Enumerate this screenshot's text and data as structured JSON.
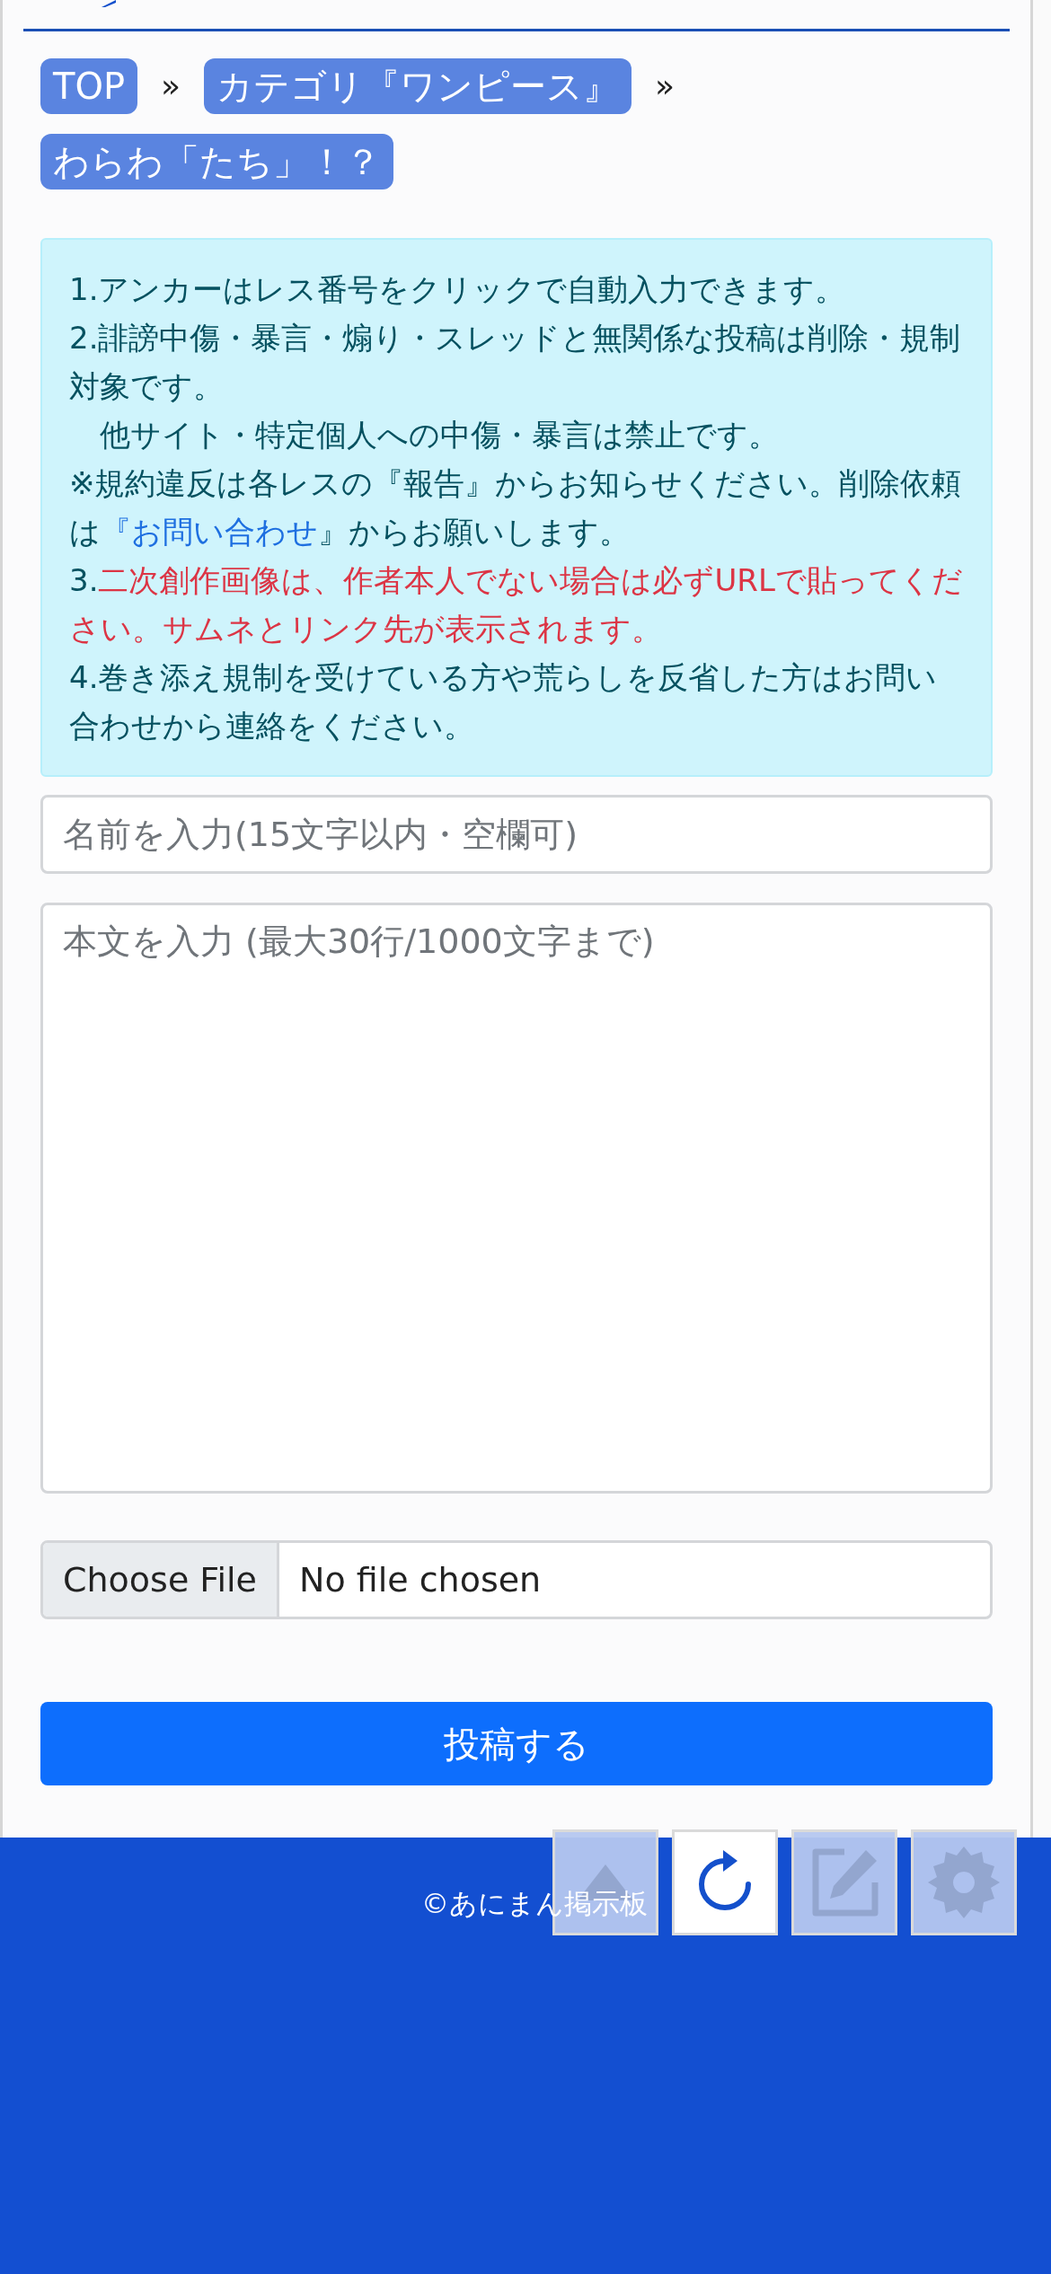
{
  "breadcrumbs": [
    {
      "label": "TOP",
      "separator": "»"
    },
    {
      "label": "カテゴリ『ワンピース』",
      "separator": "»"
    },
    {
      "label": "わらわ「たち」！？"
    }
  ],
  "notice": {
    "lines": [
      [
        {
          "kind": "text",
          "text": "1.アンカーはレス番号をクリックで自動入力できます。"
        }
      ],
      [
        {
          "kind": "text",
          "text": "2.誹謗中傷・暴言・煽り・スレッドと無関係な投稿は削除・規制対象です。"
        }
      ],
      [
        {
          "kind": "text",
          "text": "　他サイト・特定個人への中傷・暴言は禁止です。"
        }
      ],
      [
        {
          "kind": "text",
          "text": "※規約違反は各レスの『報告』からお知らせください。削除依頼は"
        },
        {
          "kind": "link",
          "text": "『お問い合わせ"
        },
        {
          "kind": "text",
          "text": "』からお願いします。"
        }
      ],
      [
        {
          "kind": "text",
          "text": "3."
        },
        {
          "kind": "alert",
          "text": "二次創作画像は、作者本人でない場合は必ずURLで貼ってください。サムネとリンク先が表示されます。"
        }
      ],
      [
        {
          "kind": "text",
          "text": "4.巻き添え規制を受けている方や荒らしを反省した方はお問い合わせから連絡をください。"
        }
      ]
    ]
  },
  "name_field": {
    "placeholder": "名前を入力(15文字以内・空欄可)"
  },
  "body_field": {
    "placeholder": "本文を入力 (最大30行/1000文字まで)"
  },
  "file_input": {
    "button": "Choose File",
    "status": "No file chosen"
  },
  "submit_button": "投稿する",
  "footer": {
    "copyright": "©あにまん掲示板"
  },
  "floating_buttons": [
    {
      "kind": "up",
      "active": false
    },
    {
      "kind": "reload",
      "active": true
    },
    {
      "kind": "edit",
      "active": false
    },
    {
      "kind": "settings",
      "active": false
    }
  ]
}
